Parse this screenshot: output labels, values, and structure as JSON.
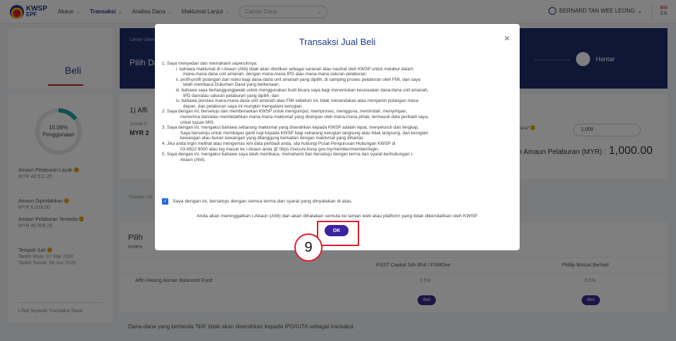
{
  "nav": {
    "logo_line1": "KWSP",
    "logo_line2": "EPF",
    "items": [
      {
        "label": "Akaun",
        "active": false
      },
      {
        "label": "Transaksi",
        "active": true
      },
      {
        "label": "Analisa Dana",
        "active": false
      },
      {
        "label": "Maklumat Lanjut",
        "active": false
      }
    ],
    "search_placeholder": "Carian Dana",
    "user_name": "BERNARD TAN WEE LEONG",
    "lang_bm": "BM",
    "lang_en": "EN"
  },
  "page": {
    "title": "Beli",
    "crumb": "Laman Utama",
    "pick_title": "Pilih Dana",
    "send_label": "Hantar"
  },
  "sidebar": {
    "usage_percent": "15.06%",
    "usage_label": "Penggunaan",
    "usage_fraction": 0.1506,
    "items": [
      {
        "label": "Amaun Pelaburan Layak",
        "value": "MYR 46,511.25"
      },
      {
        "label": "Amaun Dipindahkan",
        "value": "MYR 6,003.00"
      },
      {
        "label": "Amaun Pelaburan Tersedia",
        "value": "MYR 40,508.25"
      },
      {
        "label": "Tempoh Sah",
        "value": "Tarikh Mula: 07 Mar 2020"
      },
      {
        "label": "",
        "value": "Tarikh Tamat: 06 Jun 2020"
      }
    ],
    "history_link": "Lihat Sejarah Transaksi Saya"
  },
  "card1": {
    "heading": "1) Affi",
    "amount_label": "Jumlah P",
    "amount_value": "MYR 2",
    "dana_label": "Dana*",
    "input_value": "1,000",
    "total_label": "ah Amaun Pelaburan (MYR) :",
    "total_value": "1,000.00",
    "source": "*Sumber: Lip"
  },
  "card2": {
    "heading": "Pilih",
    "sub": "Keters",
    "col1": "iFAST Capital Sdn Bhd / FSMOne",
    "col2": "Phillip Mutual Berhad",
    "fund": "Affin Hwang Aiiman Balanced Fund",
    "pct1": "0.5%",
    "pct2": "0.5%",
    "buy_label": "Beli",
    "footnote": "Dana-dana yang bertanda 'N/A' tidak akan diserahkan kepada IPD/IUTA sebagai transaksi."
  },
  "modal": {
    "title": "Transaksi Jual Beli",
    "close": "×",
    "terms": [
      {
        "cls": "",
        "text": "1.  Saya menyedari dan memahami sepenuhnya:"
      },
      {
        "cls": "sub1",
        "text": "i. bahawa maklumat di i-Akaun (Ahli) tidak akan diertikan sebagai saranan atau nasihat oleh KWSP untuk melabur dalam"
      },
      {
        "cls": "sub3",
        "text": "mana-mana dana unit amanah, dengan mana-mana IPD atau mana-mana saluran pelaburan;"
      },
      {
        "cls": "sub1",
        "text": "ii. profil-profil pulangan dan risiko bagi dana-dana unit amanah yang dipilih, di samping proses pelaburan oleh FMI, dan saya"
      },
      {
        "cls": "sub3",
        "text": "telah membaca Dokumen Dana yang berkenaan;"
      },
      {
        "cls": "sub1",
        "text": "iii. bahawa saya bertanggungjawab untuk menggunakan budi bicara saya bagi menentukan kesesuaian dana-dana unit amanah,"
      },
      {
        "cls": "sub3",
        "text": "IPD dan/atau saluran pelaburan yang dipilih; dan"
      },
      {
        "cls": "sub1",
        "text": "iv. bahawa prestasi mana-mana dana unit amanah atau FMI sebelum ini, tidak menandakan atau menjamin pulangan masa"
      },
      {
        "cls": "sub3",
        "text": "depan, dan pelaburan saya ini mungkin mengalami kerugian."
      },
      {
        "cls": "",
        "text": "2.  Saya dengan ini, bersetuju dan membenarkan KWSP untuk mengumpul, memproses, mengguna, memindah, menyimpan,"
      },
      {
        "cls": "sub2",
        "text": "menerima dan/atau mendedahkan mana-mana maklumat yang disimpan oleh mana-mana pihak, termasuk data peribadi saya,"
      },
      {
        "cls": "sub2",
        "text": "untuk tujuan MIS."
      },
      {
        "cls": "",
        "text": "3.  Saya dengan ini, mengakui bahawa sebarang maklumat yang diserahkan kepada KWSP adalah tepat, menyeluruh dan lengkap."
      },
      {
        "cls": "sub2",
        "text": "Saya bersetuju untuk membayar ganti rugi kepada KWSP bagi sebarang kerugian langsung atau tidak langsung, dan kerugian"
      },
      {
        "cls": "sub2",
        "text": "kewangan atau bukan kewangan yang ditanggung berkaitan dengan maklumat yang dihantar."
      },
      {
        "cls": "",
        "text": "4.  Jika anda ingin melihat atau mengemas kini data peribadi anda, sila hubungi Pusat Pengurusan Hubungan KWSP di"
      },
      {
        "cls": "sub2",
        "text": "03-8922 6000 atau log masuk ke i-Akaun anda @ https://secure.kwsp.gov.my/member/member/login."
      },
      {
        "cls": "",
        "text": "5.  Saya dengan ini, mengakui bahawa saya telah membaca, memahami dan bersetuju dengan terma dan syarat berhubungan i-"
      },
      {
        "cls": "sub2",
        "text": "Akaun (Ahli)."
      }
    ],
    "agree_text": "Saya dengan ini, bersetuju dengan semua terma dan syarat yang dinyatakan di atas.",
    "leave_text": "Anda akan meninggalkan i-Akaun (Ahli) dan akan dihalakan semula ke laman web atau platform yang tidak dikendalikan oleh KWSP.",
    "ok_label": "OK"
  },
  "annotation": {
    "step_number": "9",
    "color": "#e11d2a"
  }
}
